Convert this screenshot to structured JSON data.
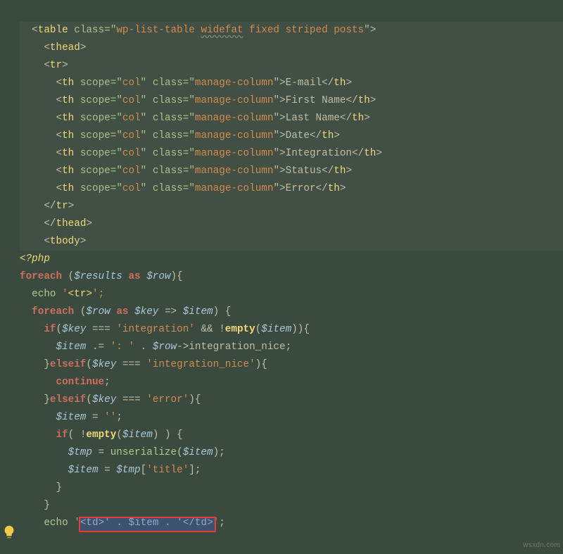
{
  "code": {
    "l1_pre": "  ",
    "l1_open": "<",
    "l1_tag": "table",
    "l1_sp": " ",
    "l1_attr": "class",
    "l1_eq": "=\"",
    "l1_v1": "wp-list-table ",
    "l1_v2": "widefat",
    "l1_v3": " fixed striped posts",
    "l1_close": "\">",
    "l2_pre": "    ",
    "l2_open": "<",
    "l2_tag": "thead",
    "l2_close": ">",
    "l3_pre": "    ",
    "l3_open": "<",
    "l3_tag": "tr",
    "l3_close": ">",
    "th_pre": "      ",
    "th_open": "<",
    "th_tag": "th",
    "th_sp": " ",
    "th_a1": "scope",
    "th_eq": "=\"",
    "th_v1": "col",
    "th_q": "\" ",
    "th_a2": "class",
    "th_v2": "manage-column",
    "th_cl": "\">",
    "th_ct": "</",
    "th_ce": ">",
    "th_txt1": "E-mail",
    "th_txt2": "First Name",
    "th_txt3": "Last Name",
    "th_txt4": "Date",
    "th_txt5": "Integration",
    "th_txt6": "Status",
    "th_txt7": "Error",
    "l11_pre": "    ",
    "l11_ct": "</",
    "l11_tag": "tr",
    "l11_ce": ">",
    "l12_tag": "thead",
    "l13_pre": "    ",
    "l13_open": "<",
    "l13_tag": "tbody",
    "l13_close": ">",
    "l14_pre": "",
    "l14_php": "<?php",
    "l15_pre": "",
    "l15_kw": "foreach",
    "l15_sp": " (",
    "l15_v1": "$results",
    "l15_as": " as ",
    "l15_v2": "$row",
    "l15_cl": "){",
    "l16_pre": "  ",
    "l16_fn": "echo",
    "l16_sp": " '",
    "l16_tag": "<tr>",
    "l16_end": "';",
    "l17_pre": "  ",
    "l17_kw": "foreach",
    "l17_sp": " (",
    "l17_v1": "$row",
    "l17_as": " as ",
    "l17_v2": "$key",
    "l17_arr": " => ",
    "l17_v3": "$item",
    "l17_cl": ") {",
    "l18_pre": "    ",
    "l18_kw": "if",
    "l18_op": "(",
    "l18_v1": "$key",
    "l18_eq": " === ",
    "l18_s1": "'integration'",
    "l18_and": " && !",
    "l18_fn": "empty",
    "l18_p2": "(",
    "l18_v2": "$item",
    "l18_cl": ")){",
    "l19_pre": "      ",
    "l19_v1": "$item",
    "l19_op": " .= ",
    "l19_s1": "': '",
    "l19_dot": " . ",
    "l19_v2": "$row",
    "l19_arr": "->",
    "l19_prop": "integration_nice",
    "l19_end": ";",
    "l20_pre": "    }",
    "l20_kw": "elseif",
    "l20_op": "(",
    "l20_v1": "$key",
    "l20_eq": " === ",
    "l20_s1": "'integration_nice'",
    "l20_cl": "){",
    "l21_pre": "      ",
    "l21_kw": "continue",
    "l21_end": ";",
    "l22_pre": "    }",
    "l22_kw": "elseif",
    "l22_op": "(",
    "l22_v1": "$key",
    "l22_eq": " === ",
    "l22_s1": "'error'",
    "l22_cl": "){",
    "l23_pre": "      ",
    "l23_v1": "$item",
    "l23_op": " = ",
    "l23_s1": "''",
    "l23_end": ";",
    "l24_pre": "      ",
    "l24_kw": "if",
    "l24_op": "( !",
    "l24_fn": "empty",
    "l24_p2": "(",
    "l24_v1": "$item",
    "l24_cl": ") ) {",
    "l25_pre": "        ",
    "l25_v1": "$tmp",
    "l25_op": " = ",
    "l25_fn": "unserialize",
    "l25_p2": "(",
    "l25_v2": "$item",
    "l25_cl": ");",
    "l26_pre": "        ",
    "l26_v1": "$item",
    "l26_op": " = ",
    "l26_v2": "$tmp",
    "l26_br": "[",
    "l26_s1": "'title'",
    "l26_cl": "];",
    "l27_pre": "      }",
    "l28_pre": "    }",
    "l29_pre": "    ",
    "l29_fn": "echo",
    "l29_sp1": " ",
    "l29_q1": "'",
    "l29_tag1": "<td>",
    "l29_q2": "'",
    "l29_dot1": " . ",
    "l29_v1": "$item",
    "l29_dot2": " . ",
    "l29_q3": "'",
    "l29_tag2": "</td>",
    "l29_q4": "'",
    "l29_end": ";"
  },
  "watermark": "wsxdn.com"
}
